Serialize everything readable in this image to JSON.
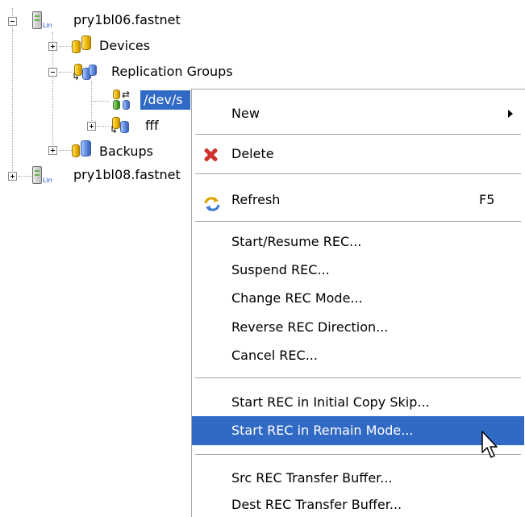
{
  "tree": {
    "nodes": [
      {
        "id": "host1",
        "label": "pry1bl06.fastnet",
        "icon": "server-icon",
        "os_badge": "Lin",
        "expanded": true
      },
      {
        "id": "devices",
        "label": "Devices",
        "icon": "devices-icon",
        "expanded": false
      },
      {
        "id": "repl",
        "label": "Replication Groups",
        "icon": "replication-groups-icon",
        "expanded": true
      },
      {
        "id": "dev",
        "label": "/dev/s",
        "icon": "replication-pair-icon",
        "selected": true
      },
      {
        "id": "fff",
        "label": "fff",
        "icon": "replication-group-icon",
        "expanded": false
      },
      {
        "id": "backups",
        "label": "Backups",
        "icon": "backups-icon",
        "expanded": false
      },
      {
        "id": "host2",
        "label": "pry1bl08.fastnet",
        "icon": "server-icon",
        "os_badge": "Lin",
        "expanded": false
      }
    ]
  },
  "menu": {
    "new": {
      "label": "New"
    },
    "delete": {
      "label": "Delete",
      "icon": "delete-icon"
    },
    "refresh": {
      "label": "Refresh",
      "shortcut": "F5",
      "icon": "refresh-icon"
    },
    "start_resume": {
      "label": "Start/Resume REC..."
    },
    "suspend": {
      "label": "Suspend REC..."
    },
    "change_mode": {
      "label": "Change REC Mode..."
    },
    "reverse_direction": {
      "label": "Reverse REC Direction..."
    },
    "cancel": {
      "label": "Cancel REC..."
    },
    "start_initial_copy_skip": {
      "label": "Start REC in Initial Copy Skip..."
    },
    "start_remain_mode": {
      "label": "Start REC in Remain Mode...",
      "highlighted": true
    },
    "src_buffer": {
      "label": "Src REC Transfer Buffer..."
    },
    "dest_buffer": {
      "label": "Dest REC Transfer Buffer..."
    }
  },
  "colors": {
    "selection": "#316ac5",
    "menu_border": "#a8a8a8",
    "tree_lines": "#a0a0a0"
  }
}
